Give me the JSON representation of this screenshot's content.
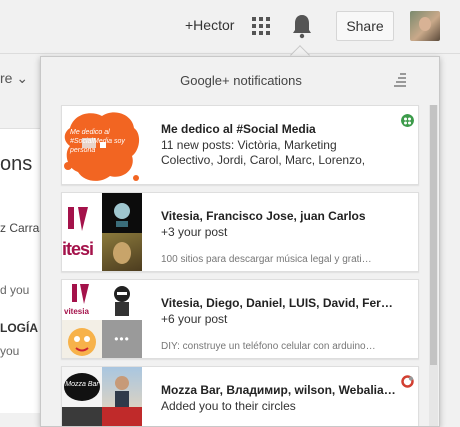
{
  "topbar": {
    "user_link": "+Hector",
    "share_label": "Share"
  },
  "background": {
    "filter_label": "re ⌄",
    "heading_fragment": "ons",
    "name_fragment": "z Carras",
    "text_fragment_1": "d you",
    "label_fragment": "LOGÍA",
    "text_fragment_2": "you"
  },
  "panel": {
    "title": "Google+ notifications"
  },
  "notifications": [
    {
      "title": "Me dedico al #Social Media",
      "line1": "11 new posts: Victòria, Marketing",
      "line2": "Colectivo, Jordi, Carol, Marc, Lorenzo,",
      "thumb_text": "Me dedico al #SocialMedia soy persona",
      "badge_icon": "community-icon",
      "badge_color": "#3c9b4a"
    },
    {
      "title": "Vitesia, Francisco Jose, juan Carlos",
      "line1": "+3 your post",
      "snippet": "100 sitios para descargar música legal y grati…",
      "thumb_logo": "itesi"
    },
    {
      "title": "Vitesia, Diego, Daniel, LUIS, David, Fern…",
      "line1": "+6 your post",
      "snippet": "DIY: construye un teléfono celular con arduino…",
      "thumb_logo": "vitesia",
      "more_label": "•••"
    },
    {
      "title": "Mozza Bar, Владимир, wilson, Webalia,…",
      "line1": "Added you to their circles",
      "thumb_text": "Mozza Bar",
      "badge_icon": "circles-icon",
      "badge_color": "#d23f31"
    }
  ],
  "colors": {
    "accent_orange": "#f26522",
    "vitesia_red": "#a4124a"
  }
}
